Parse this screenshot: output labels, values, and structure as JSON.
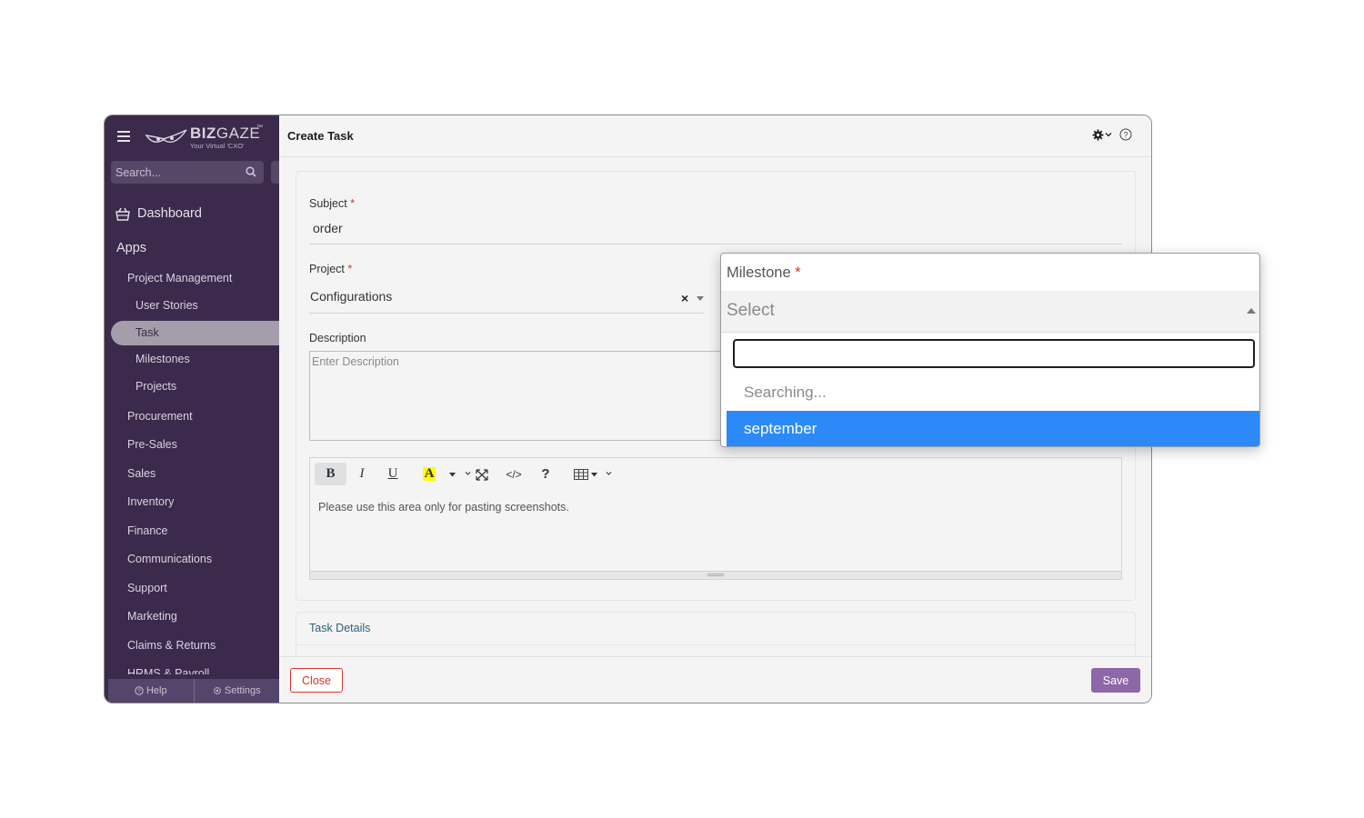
{
  "sidebar": {
    "brand": {
      "name_bold": "BIZ",
      "name_light": "GAZE",
      "trademark": "™",
      "tagline": "Your Virtual 'CXO'"
    },
    "search": {
      "placeholder": "Search..."
    },
    "dashboard_label": "Dashboard",
    "apps_label": "Apps",
    "items": [
      {
        "label": "Project Management"
      },
      {
        "label": "User Stories"
      },
      {
        "label": "Task"
      },
      {
        "label": "Milestones"
      },
      {
        "label": "Projects"
      },
      {
        "label": "Procurement"
      },
      {
        "label": "Pre-Sales"
      },
      {
        "label": "Sales"
      },
      {
        "label": "Inventory"
      },
      {
        "label": "Finance"
      },
      {
        "label": "Communications"
      },
      {
        "label": "Support"
      },
      {
        "label": "Marketing"
      },
      {
        "label": "Claims & Returns"
      },
      {
        "label": "HRMS & Payroll"
      }
    ],
    "footer": {
      "help_label": "Help",
      "settings_label": "Settings"
    }
  },
  "header": {
    "title": "Create Task"
  },
  "form": {
    "subject": {
      "label": "Subject",
      "required_mark": "*",
      "value": "order"
    },
    "project": {
      "label": "Project",
      "required_mark": "*",
      "value": "Configurations",
      "clear_glyph": "×"
    },
    "description": {
      "label": "Description",
      "placeholder": "Enter Description"
    },
    "editor": {
      "bold": "B",
      "italic": "I",
      "underline": "U",
      "highlight": "A",
      "code": "</>",
      "help": "?",
      "body_text": "Please use this area only for pasting screenshots."
    },
    "task_details_label": "Task Details"
  },
  "footer": {
    "close_label": "Close",
    "save_label": "Save"
  },
  "milestone_popup": {
    "label": "Milestone",
    "required_mark": "*",
    "select_placeholder": "Select",
    "status_text": "Searching...",
    "options": [
      {
        "label": "september",
        "highlighted": true
      }
    ]
  },
  "colors": {
    "sidebar_bg": "#3b2a4b",
    "accent_save": "#8e67a7",
    "danger": "#d9342b",
    "option_highlight": "#2b8af7"
  }
}
